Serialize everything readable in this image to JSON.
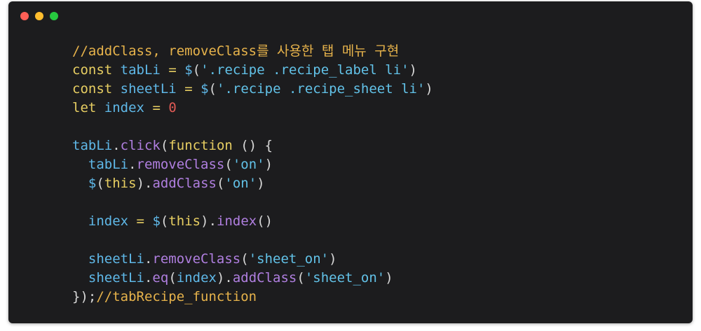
{
  "window_controls": {
    "close_color": "#ff5f56",
    "minimize_color": "#ffbd2e",
    "maximize_color": "#27c93f"
  },
  "code": {
    "lines": [
      [
        [
          "comment",
          "//addClass, removeClass를 사용한 탭 메뉴 구현"
        ]
      ],
      [
        [
          "keyword",
          "const"
        ],
        [
          "punc",
          " "
        ],
        [
          "var",
          "tabLi"
        ],
        [
          "punc",
          " "
        ],
        [
          "op",
          "="
        ],
        [
          "punc",
          " "
        ],
        [
          "var",
          "$"
        ],
        [
          "punc",
          "("
        ],
        [
          "str",
          "'.recipe .recipe_label li'"
        ],
        [
          "punc",
          ")"
        ]
      ],
      [
        [
          "keyword",
          "const"
        ],
        [
          "punc",
          " "
        ],
        [
          "var",
          "sheetLi"
        ],
        [
          "punc",
          " "
        ],
        [
          "op",
          "="
        ],
        [
          "punc",
          " "
        ],
        [
          "var",
          "$"
        ],
        [
          "punc",
          "("
        ],
        [
          "str",
          "'.recipe .recipe_sheet li'"
        ],
        [
          "punc",
          ")"
        ]
      ],
      [
        [
          "keyword",
          "let"
        ],
        [
          "punc",
          " "
        ],
        [
          "var",
          "index"
        ],
        [
          "punc",
          " "
        ],
        [
          "op",
          "="
        ],
        [
          "punc",
          " "
        ],
        [
          "num",
          "0"
        ]
      ],
      [],
      [
        [
          "var",
          "tabLi"
        ],
        [
          "punc",
          "."
        ],
        [
          "method",
          "click"
        ],
        [
          "punc",
          "("
        ],
        [
          "keyword",
          "function"
        ],
        [
          "punc",
          " () {"
        ]
      ],
      [
        [
          "punc",
          "  "
        ],
        [
          "var",
          "tabLi"
        ],
        [
          "punc",
          "."
        ],
        [
          "method",
          "removeClass"
        ],
        [
          "punc",
          "("
        ],
        [
          "str",
          "'on'"
        ],
        [
          "punc",
          ")"
        ]
      ],
      [
        [
          "punc",
          "  "
        ],
        [
          "var",
          "$"
        ],
        [
          "punc",
          "("
        ],
        [
          "keyword",
          "this"
        ],
        [
          "punc",
          ")."
        ],
        [
          "method",
          "addClass"
        ],
        [
          "punc",
          "("
        ],
        [
          "str",
          "'on'"
        ],
        [
          "punc",
          ")"
        ]
      ],
      [],
      [
        [
          "punc",
          "  "
        ],
        [
          "var",
          "index"
        ],
        [
          "punc",
          " "
        ],
        [
          "op",
          "="
        ],
        [
          "punc",
          " "
        ],
        [
          "var",
          "$"
        ],
        [
          "punc",
          "("
        ],
        [
          "keyword",
          "this"
        ],
        [
          "punc",
          ")."
        ],
        [
          "method",
          "index"
        ],
        [
          "punc",
          "()"
        ]
      ],
      [],
      [
        [
          "punc",
          "  "
        ],
        [
          "var",
          "sheetLi"
        ],
        [
          "punc",
          "."
        ],
        [
          "method",
          "removeClass"
        ],
        [
          "punc",
          "("
        ],
        [
          "str",
          "'sheet_on'"
        ],
        [
          "punc",
          ")"
        ]
      ],
      [
        [
          "punc",
          "  "
        ],
        [
          "var",
          "sheetLi"
        ],
        [
          "punc",
          "."
        ],
        [
          "method",
          "eq"
        ],
        [
          "punc",
          "("
        ],
        [
          "var",
          "index"
        ],
        [
          "punc",
          ")."
        ],
        [
          "method",
          "addClass"
        ],
        [
          "punc",
          "("
        ],
        [
          "str",
          "'sheet_on'"
        ],
        [
          "punc",
          ")"
        ]
      ],
      [
        [
          "punc",
          "});"
        ],
        [
          "comment",
          "//tabRecipe_function"
        ]
      ]
    ]
  }
}
